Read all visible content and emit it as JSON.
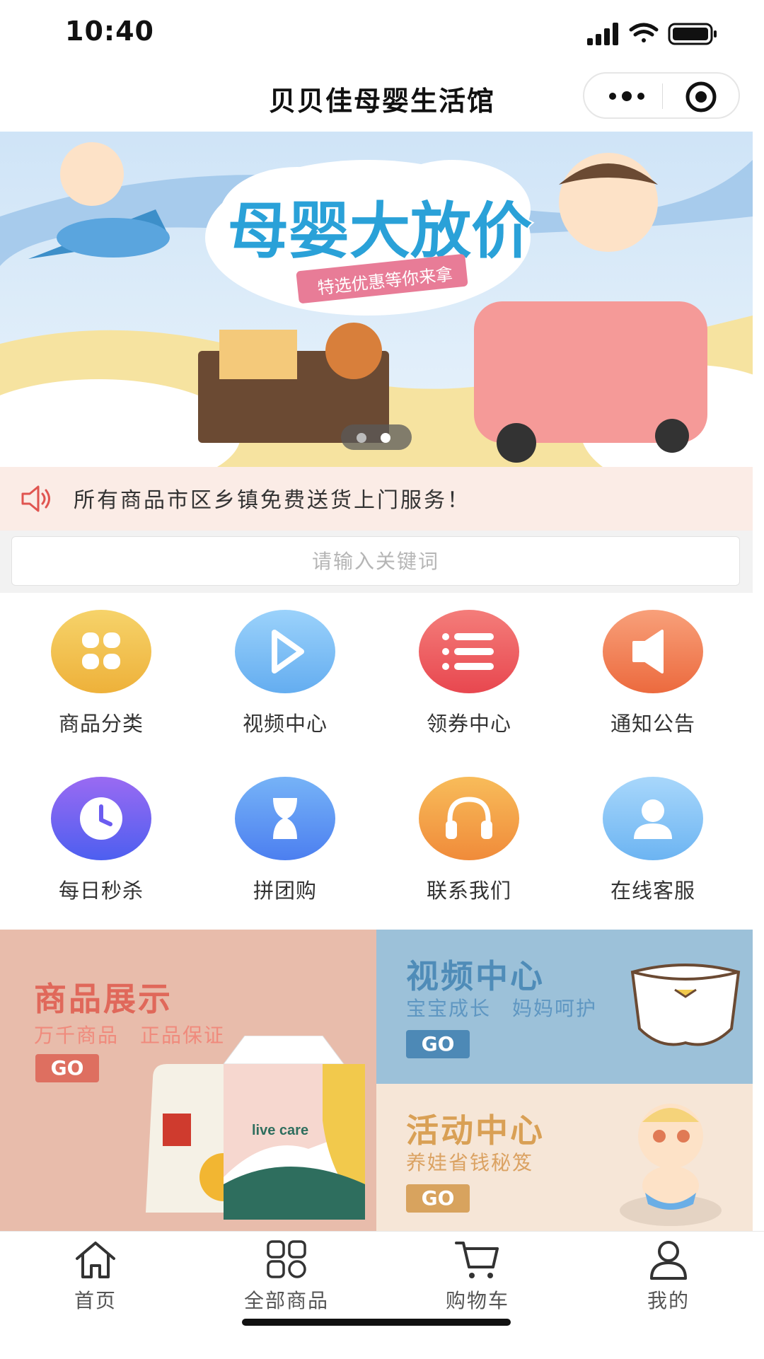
{
  "status_bar": {
    "time": "10:40"
  },
  "nav": {
    "title": "贝贝佳母婴生活馆",
    "more_icon": "more-dots-icon",
    "close_icon": "target-circle-icon"
  },
  "banner": {
    "headline": "母婴大放价",
    "ribbon": "特选优惠等你来拿",
    "slide_count": 2,
    "active_slide": 1
  },
  "notice": {
    "icon": "speaker-icon",
    "text": "所有商品市区乡镇免费送货上门服务！"
  },
  "search": {
    "placeholder": "请输入关键词",
    "value": ""
  },
  "grid": {
    "items": [
      {
        "label": "商品分类",
        "icon": "category-grid-icon",
        "color": "#f2c04e"
      },
      {
        "label": "视频中心",
        "icon": "play-icon",
        "color": "#78bdf5"
      },
      {
        "label": "领券中心",
        "icon": "list-icon",
        "color": "#ee5a5e"
      },
      {
        "label": "通知公告",
        "icon": "speaker-icon",
        "color": "#f07a4e"
      },
      {
        "label": "每日秒杀",
        "icon": "clock-icon",
        "color": "#6e5ef0"
      },
      {
        "label": "拼团购",
        "icon": "hourglass-icon",
        "color": "#5b8ff2"
      },
      {
        "label": "联系我们",
        "icon": "headphones-icon",
        "color": "#f5a244"
      },
      {
        "label": "在线客服",
        "icon": "user-icon",
        "color": "#7cc2f5"
      }
    ]
  },
  "promo": {
    "left": {
      "title": "商品展示",
      "subtitle": "万千商品　正品保证",
      "go": "GO",
      "product_text": "live care"
    },
    "right_top": {
      "title": "视频中心",
      "subtitle": "宝宝成长　妈妈呵护",
      "go": "GO"
    },
    "right_bottom": {
      "title": "活动中心",
      "subtitle": "养娃省钱秘笈",
      "go": "GO"
    }
  },
  "colors": {
    "accent_red": "#e05550",
    "promo_left_bg": "#e8bcab",
    "promo_rt_bg": "#9cc1d9",
    "promo_rb_bg": "#f6e6d7"
  },
  "tabbar": {
    "items": [
      {
        "label": "首页",
        "icon": "home-icon"
      },
      {
        "label": "全部商品",
        "icon": "apps-grid-icon"
      },
      {
        "label": "购物车",
        "icon": "cart-icon"
      },
      {
        "label": "我的",
        "icon": "person-icon"
      }
    ]
  }
}
